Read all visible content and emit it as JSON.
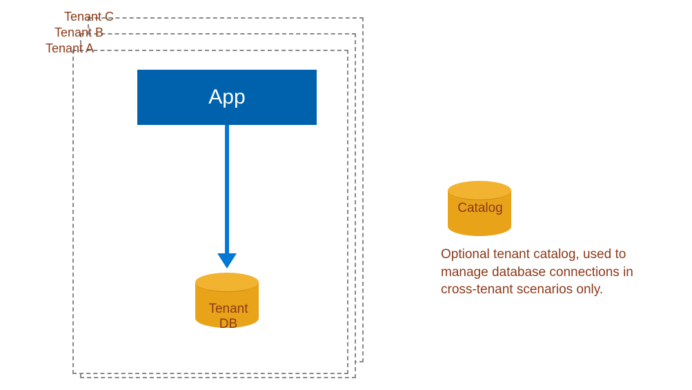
{
  "tenants": {
    "c": "Tenant C",
    "b": "Tenant B",
    "a": "Tenant A"
  },
  "app": {
    "label": "App"
  },
  "tenant_db": {
    "label": "Tenant DB"
  },
  "catalog": {
    "label": "Catalog",
    "description": "Optional tenant catalog, used to manage database connections in cross-tenant scenarios only."
  }
}
